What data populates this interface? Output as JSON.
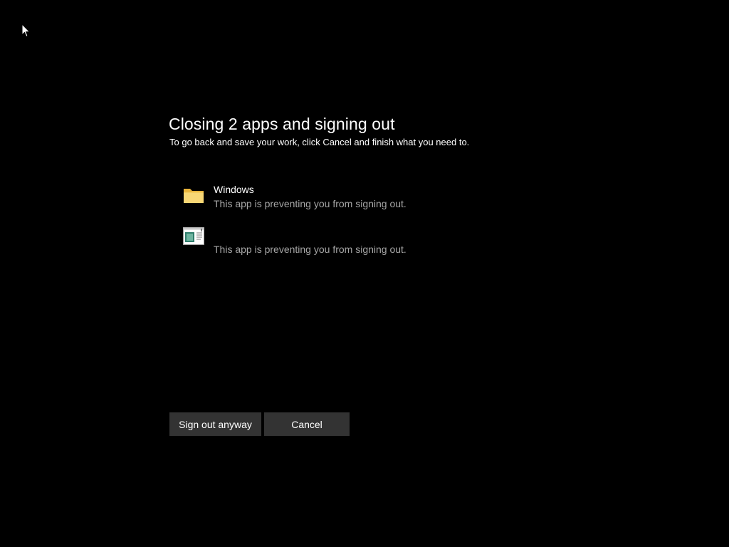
{
  "dialog": {
    "title": "Closing 2 apps and signing out",
    "subtitle": "To go back and save your work, click Cancel and finish what you need to."
  },
  "apps": [
    {
      "name": "Windows",
      "status": "This app is preventing you from signing out.",
      "icon": "folder-icon"
    },
    {
      "name": "",
      "status": "This app is preventing you from signing out.",
      "icon": "app-window-icon"
    }
  ],
  "buttons": {
    "sign_out_label": "Sign out anyway",
    "cancel_label": "Cancel"
  },
  "colors": {
    "background": "#000000",
    "text_primary": "#ffffff",
    "text_secondary": "#a6a6a6",
    "button_bg": "#333333",
    "folder_yellow": "#f8d775"
  }
}
